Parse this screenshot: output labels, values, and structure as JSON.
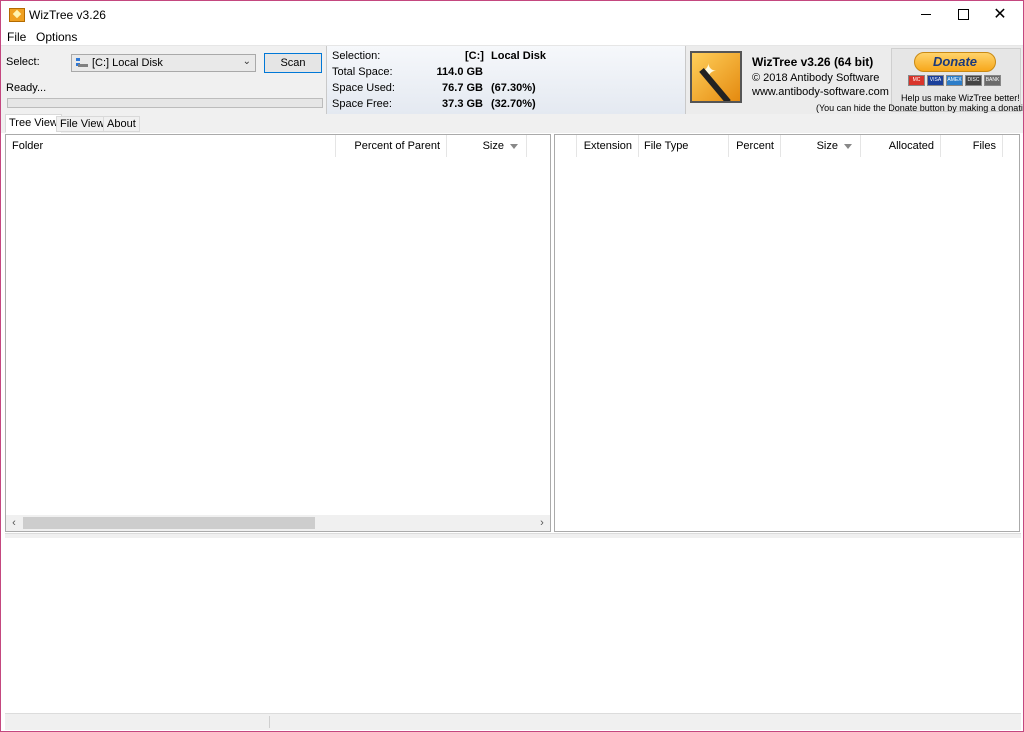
{
  "window": {
    "title": "WizTree v3.26"
  },
  "menu": {
    "file": "File",
    "options": "Options"
  },
  "selector": {
    "select_label": "Select:",
    "drive_value": "[C:] Local Disk",
    "scan_label": "Scan",
    "status": "Ready..."
  },
  "progress": {
    "fraction": 0.0
  },
  "stats": {
    "selection_label": "Selection:",
    "selection_drive": "[C:]",
    "selection_name": "Local Disk",
    "total_label": "Total Space:",
    "total_value": "114.0 GB",
    "used_label": "Space Used:",
    "used_value": "76.7 GB",
    "used_percent": "(67.30%)",
    "free_label": "Space Free:",
    "free_value": "37.3 GB",
    "free_percent": "(32.70%)"
  },
  "banner": {
    "product": "WizTree v3.26 (64 bit)",
    "copyright": "© 2018 Antibody Software",
    "website": "www.antibody-software.com",
    "donate_label": "Donate",
    "help_text": "Help us make WizTree better!",
    "hide_note": "(You can hide the Donate button by making a donation)",
    "cards": [
      "MC",
      "VISA",
      "AMEX",
      "DISC",
      "BANK"
    ]
  },
  "tabs": [
    "Tree View",
    "File View",
    "About"
  ],
  "tree_columns": [
    "Folder",
    "Percent of Parent",
    "Size"
  ],
  "ext_columns": [
    "Extension",
    "File Type",
    "Percent",
    "Size",
    "Allocated",
    "Files"
  ],
  "colors": {
    "accent": "#0078d7",
    "window_border": "#c4477f",
    "donate": "#f7a71b"
  }
}
